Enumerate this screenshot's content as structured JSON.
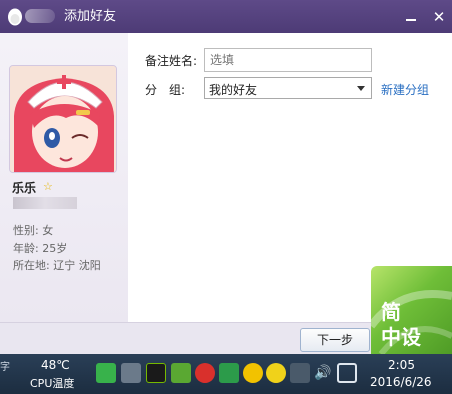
{
  "window": {
    "title": "添加好友"
  },
  "profile": {
    "nickname": "乐乐",
    "gender": "性别: 女",
    "age": "年龄: 25岁",
    "location": "所在地: 辽宁  沈阳"
  },
  "form": {
    "remark_label": "备注姓名:",
    "remark_placeholder": "选填",
    "group_label": "分　组:",
    "group_value": "我的好友",
    "new_group_link": "新建分组"
  },
  "footer": {
    "next_button": "下一步"
  },
  "watermark": {
    "line1": "简",
    "line2": "中设"
  },
  "taskbar": {
    "left_text": "字",
    "temperature": "48℃",
    "cpu_label": "CPU温度",
    "time": "2:05",
    "date": "2016/6/26"
  }
}
